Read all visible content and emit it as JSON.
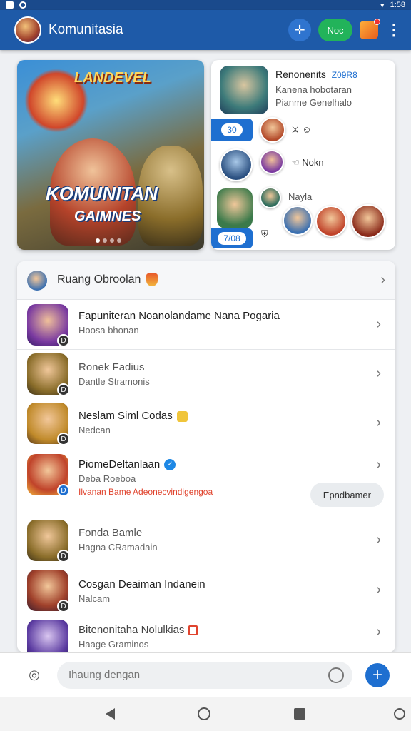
{
  "status_bar": {
    "time": "1:58"
  },
  "app_bar": {
    "title": "Komunitasia",
    "new_label": "Noc"
  },
  "hero": {
    "top_word": "LANDEVEL",
    "big_word": "KOMUNITAN",
    "sub_word": "GAIMNES"
  },
  "featured": {
    "name": "Renonenits",
    "tag": "Z09R8",
    "sub1": "Kanena hobotaran",
    "sub2": "Pianme Genelhalo",
    "stat1": "30",
    "stat2": "7/08",
    "label_nokn": "Nokn",
    "label_nayla": "Nayla"
  },
  "list": {
    "header": "Ruang Obroolan",
    "rows": [
      {
        "title": "Fapuniteran Noanolandame Nana Pogaria",
        "sub": "Hoosa bhonan",
        "extra": "",
        "badge": "D"
      },
      {
        "title": "Ronek Fadius",
        "sub": "Dantle Stramonis",
        "extra": "",
        "badge": "D"
      },
      {
        "title": "Neslam Siml Codas",
        "sub": "Nedcan",
        "extra": "",
        "badge": "D"
      },
      {
        "title": "PiomeDeltanlaan",
        "sub": "Deba Roeboa",
        "extra": "Ilvanan Bame Adeonecvindigengoa",
        "badge": "D"
      },
      {
        "title": "Fonda Bamle",
        "sub": "Hagna CRamadain",
        "extra": "",
        "badge": "D"
      },
      {
        "title": "Cosgan Deaiman Indanein",
        "sub": "Nalcam",
        "extra": "",
        "badge": "D"
      },
      {
        "title": "Bitenonitaha Nolulkias",
        "sub": "Haage Graminos",
        "extra": "",
        "badge": "D"
      }
    ],
    "popup_button": "Epndbamer"
  },
  "composer": {
    "placeholder": "Ihaung dengan"
  },
  "colors": {
    "app_bar": "#1e5aa8",
    "accent": "#1e6fd0",
    "new_button": "#22b35a",
    "alert_text": "#e0442e"
  },
  "icons": [
    "camera-icon",
    "emoji-icon",
    "plus-icon",
    "compass-icon",
    "gift-icon",
    "more-icon",
    "chevron-right-icon",
    "verified-icon",
    "back-icon",
    "home-icon",
    "recents-icon"
  ]
}
